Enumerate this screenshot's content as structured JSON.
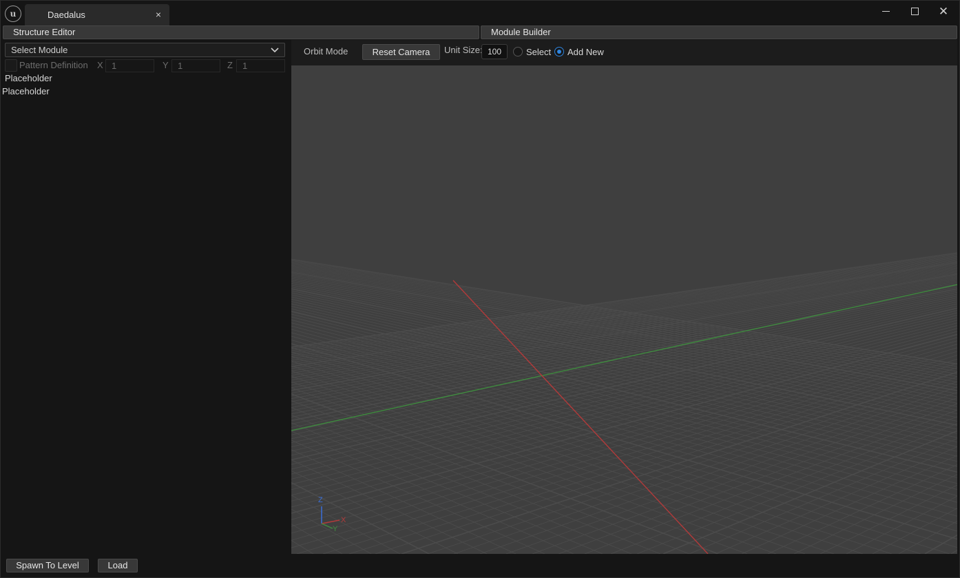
{
  "window": {
    "tab_title": "Daedalus",
    "tab_close": "×",
    "controls": {
      "close": "✕"
    }
  },
  "headers": {
    "left": "Structure Editor",
    "right": "Module Builder"
  },
  "left_panel": {
    "module_select": {
      "value": "Select Module"
    },
    "pattern": {
      "label": "Pattern Definition",
      "checked": false,
      "x_label": "X",
      "x_value": "1",
      "y_label": "Y",
      "y_value": "1",
      "z_label": "Z",
      "z_value": "1"
    },
    "items": [
      "Placeholder",
      "Placeholder"
    ]
  },
  "toolbar": {
    "orbit_mode": "Orbit Mode",
    "reset_camera": "Reset Camera",
    "unit_size_label": "Unit Size:",
    "unit_size_value": "100",
    "radio_select": "Select",
    "radio_add_new": "Add New",
    "selected_mode": "Add New"
  },
  "viewport": {
    "axis_gizmo": {
      "z": "Z",
      "x": "X",
      "y": "Y"
    },
    "colors": {
      "background": "#3f3f3f",
      "grid": "#4d4d4d",
      "x_axis": "#b23a3a",
      "y_axis": "#3f8a3f",
      "z_axis": "#3a6fd8"
    }
  },
  "bottom": {
    "spawn": "Spawn To Level",
    "load": "Load"
  }
}
